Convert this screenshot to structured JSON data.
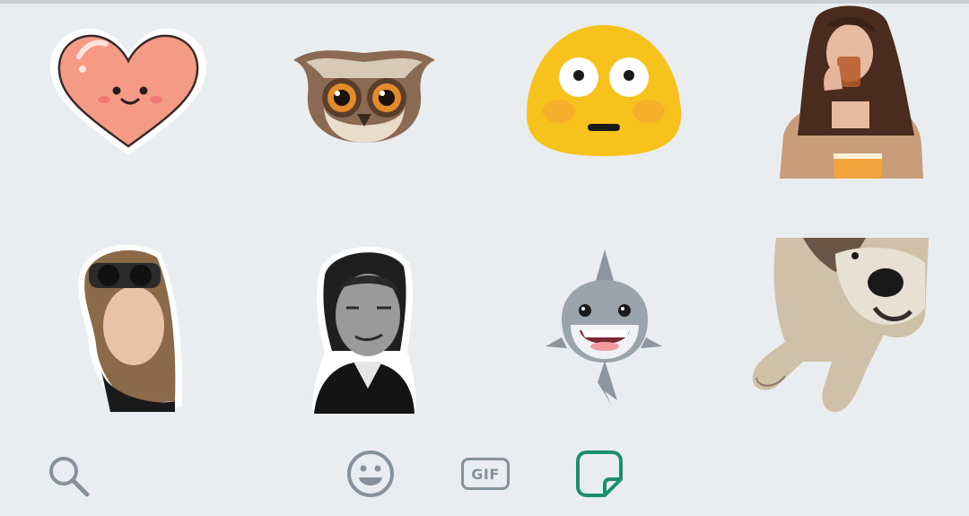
{
  "colors": {
    "background": "#e9edf0",
    "icon_inactive": "#86929a",
    "icon_active": "#1a8f6e"
  },
  "stickers": [
    {
      "name": "heart-sticker",
      "description": "heart"
    },
    {
      "name": "owl-sticker",
      "description": "owl"
    },
    {
      "name": "flushed-blob-sticker",
      "description": "flushed-face"
    },
    {
      "name": "woman-drinking-sticker",
      "description": "photo"
    },
    {
      "name": "woman-selfie-sticker",
      "description": "photo"
    },
    {
      "name": "man-portrait-sticker",
      "description": "photo"
    },
    {
      "name": "shark-sticker",
      "description": "shark"
    },
    {
      "name": "dog-sticker",
      "description": "photo"
    }
  ],
  "toolbar": {
    "search_icon": "search-icon",
    "emoji_icon": "emoji-icon",
    "gif_label": "GIF",
    "sticker_icon": "sticker-icon",
    "active_tab": "stickers"
  }
}
